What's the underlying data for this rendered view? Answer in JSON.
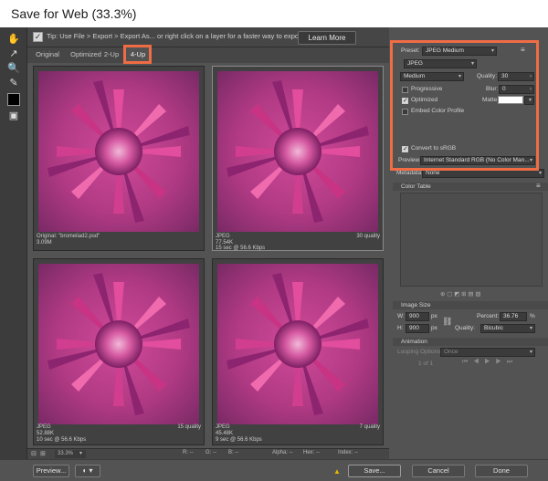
{
  "window": {
    "title": "Save for Web (33.3%)"
  },
  "tip": {
    "text": "Tip: Use File > Export > Export As... or right click on a layer for a faster way to export assets",
    "learn_more": "Learn More"
  },
  "tabs": [
    {
      "label": "Original"
    },
    {
      "label": "Optimized"
    },
    {
      "label": "2-Up"
    },
    {
      "label": "4-Up",
      "active": true
    }
  ],
  "previews": [
    {
      "line1": "Original: \"bromeliad2.psd\"",
      "line2": "3.09M",
      "line3": "",
      "quality": ""
    },
    {
      "line1": "JPEG",
      "line2": "77.54K",
      "line3": "15 sec @ 56.6 Kbps",
      "quality": "30 quality"
    },
    {
      "line1": "JPEG",
      "line2": "52.88K",
      "line3": "10 sec @ 56.6 Kbps",
      "quality": "15 quality"
    },
    {
      "line1": "JPEG",
      "line2": "45.48K",
      "line3": "9 sec @ 56.6 Kbps",
      "quality": "7 quality"
    }
  ],
  "settings": {
    "preset_label": "Preset:",
    "preset_value": "JPEG Medium",
    "format": "JPEG",
    "compression": "Medium",
    "quality_label": "Quality:",
    "quality_value": "30",
    "progressive": "Progressive",
    "blur_label": "Blur:",
    "blur_value": "0",
    "optimized": "Optimized",
    "matte_label": "Matte:",
    "embed_profile": "Embed Color Profile",
    "convert_srgb": "Convert to sRGB",
    "preview_label": "Preview:",
    "preview_value": "Internet Standard RGB (No Color Man...",
    "metadata_label": "Metadata:",
    "metadata_value": "None"
  },
  "color_table": {
    "title": "Color Table"
  },
  "image_size": {
    "title": "Image Size",
    "w_label": "W:",
    "w_value": "900",
    "w_unit": "px",
    "h_label": "H:",
    "h_value": "900",
    "h_unit": "px",
    "percent_label": "Percent:",
    "percent_value": "36.76",
    "percent_unit": "%",
    "quality_label": "Quality:",
    "quality_value": "Bicubic"
  },
  "animation": {
    "title": "Animation",
    "looping_label": "Looping Options:",
    "looping_value": "Once",
    "frame": "1 of 1"
  },
  "status": {
    "zoom": "33.3%",
    "r": "R: --",
    "g": "G: --",
    "b": "B: --",
    "alpha": "Alpha: --",
    "hex": "Hex: --",
    "index": "Index: --"
  },
  "buttons": {
    "preview": "Preview...",
    "save": "Save...",
    "cancel": "Cancel",
    "done": "Done"
  },
  "colors": {
    "highlight": "#ef6c45",
    "panel": "#535353"
  }
}
